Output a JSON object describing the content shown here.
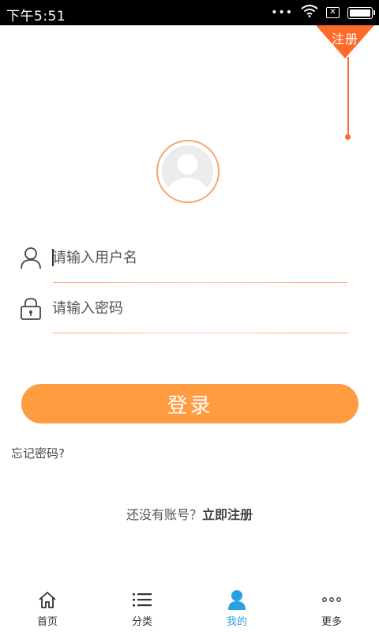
{
  "status_bar": {
    "time": "下午5:51",
    "icons": [
      "more-dots-icon",
      "wifi-icon",
      "sim-icon",
      "battery-icon"
    ]
  },
  "corner": {
    "register_label": "注册",
    "accent_color": "#fe6a2a"
  },
  "form": {
    "username_placeholder": "请输入用户名",
    "username_value": "",
    "password_placeholder": "请输入密码",
    "password_value": ""
  },
  "login_button": {
    "label": "登录",
    "color": "#ff9b41"
  },
  "forgot_password": "忘记密码?",
  "register_hint": {
    "prefix": "还没有账号？",
    "link": "立即注册"
  },
  "bottom_nav": {
    "items": [
      {
        "label": "首页",
        "icon": "home-icon",
        "active": false
      },
      {
        "label": "分类",
        "icon": "list-icon",
        "active": false
      },
      {
        "label": "我的",
        "icon": "person-icon",
        "active": true
      },
      {
        "label": "更多",
        "icon": "more-dots-icon",
        "active": false
      }
    ],
    "active_color": "#2aa0e4"
  }
}
